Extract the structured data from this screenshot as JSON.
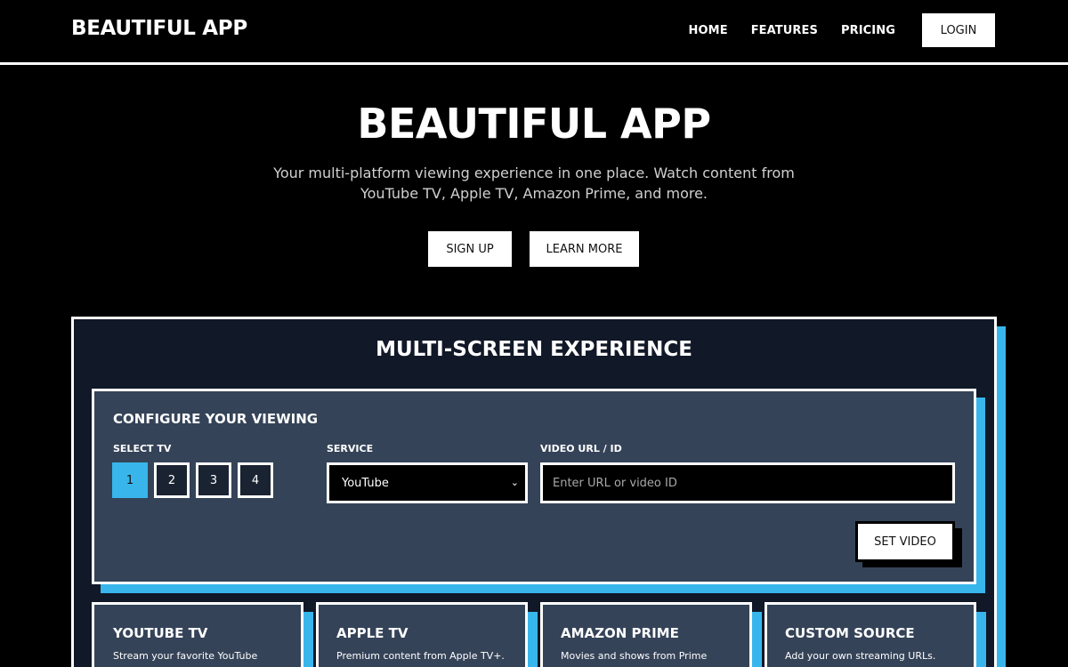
{
  "header": {
    "brand": "BEAUTIFUL APP",
    "nav": [
      "HOME",
      "FEATURES",
      "PRICING"
    ],
    "login_label": "LOGIN"
  },
  "hero": {
    "title": "BEAUTIFUL APP",
    "subtitle_line1": "Your multi-platform viewing experience in one place. Watch content from",
    "subtitle_line2": "YouTube TV, Apple TV, Amazon Prime, and more.",
    "signup_label": "SIGN UP",
    "learn_more_label": "LEARN MORE"
  },
  "panel": {
    "title": "MULTI-SCREEN EXPERIENCE",
    "config": {
      "title": "CONFIGURE YOUR VIEWING",
      "select_tv_label": "SELECT TV",
      "tv_options": [
        "1",
        "2",
        "3",
        "4"
      ],
      "active_tv": "1",
      "service_label": "SERVICE",
      "service_value": "YouTube",
      "url_label": "VIDEO URL / ID",
      "url_placeholder": "Enter URL or video ID",
      "set_video_label": "SET VIDEO"
    },
    "cards": [
      {
        "title": "YOUTUBE TV",
        "desc": "Stream your favorite YouTube"
      },
      {
        "title": "APPLE TV",
        "desc": "Premium content from Apple TV+."
      },
      {
        "title": "AMAZON PRIME",
        "desc": "Movies and shows from Prime"
      },
      {
        "title": "CUSTOM SOURCE",
        "desc": "Add your own streaming URLs."
      }
    ]
  },
  "colors": {
    "accent": "#38b6ec",
    "panel_bg": "#111827",
    "card_bg": "#354358",
    "page_bg": "#000000"
  }
}
